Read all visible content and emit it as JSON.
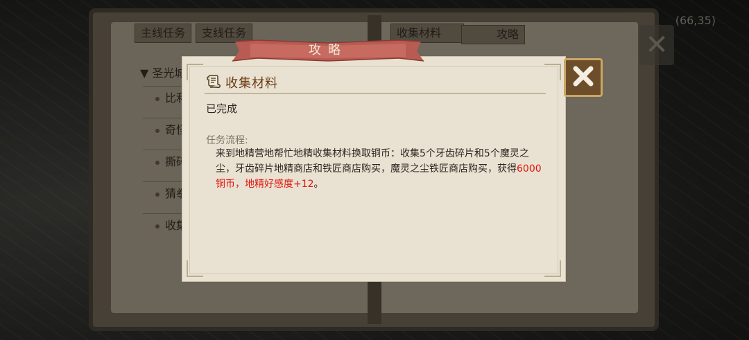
{
  "background": {
    "coords_text": "(66,35)",
    "tabs": [
      {
        "label": "主线任务"
      },
      {
        "label": "支线任务"
      }
    ],
    "group_label": "▼ 圣光城",
    "items": [
      {
        "label": "比利"
      },
      {
        "label": "奇怪"
      },
      {
        "label": "撕碎"
      },
      {
        "label": "猜拳"
      },
      {
        "label": "收集"
      }
    ],
    "right_tab": "收集材料",
    "strategy_label": "攻略"
  },
  "dialog": {
    "title": "攻略",
    "section_title": "收集材料",
    "status": "已完成",
    "flow_label": "任务流程:",
    "flow_text_1": "来到地精营地帮忙地精收集材料换取铜币：收集5个牙齿碎片和5个魔灵之尘，牙齿碎片地精商店和铁匠商店购买，魔灵之尘铁匠商店购买，获得",
    "flow_reward_1": "6000铜币",
    "flow_reward_2": "，地精好感度+12",
    "flow_end": "。"
  },
  "colors": {
    "ribbon": "#b85b52",
    "dialog_bg": "#e9e2d2",
    "highlight": "#e2140e",
    "title_brown": "#6a3b12",
    "close_bg": "#6d4e2a"
  },
  "icons": {
    "section_icon": "scroll-icon",
    "close_icon": "close-x-icon"
  }
}
